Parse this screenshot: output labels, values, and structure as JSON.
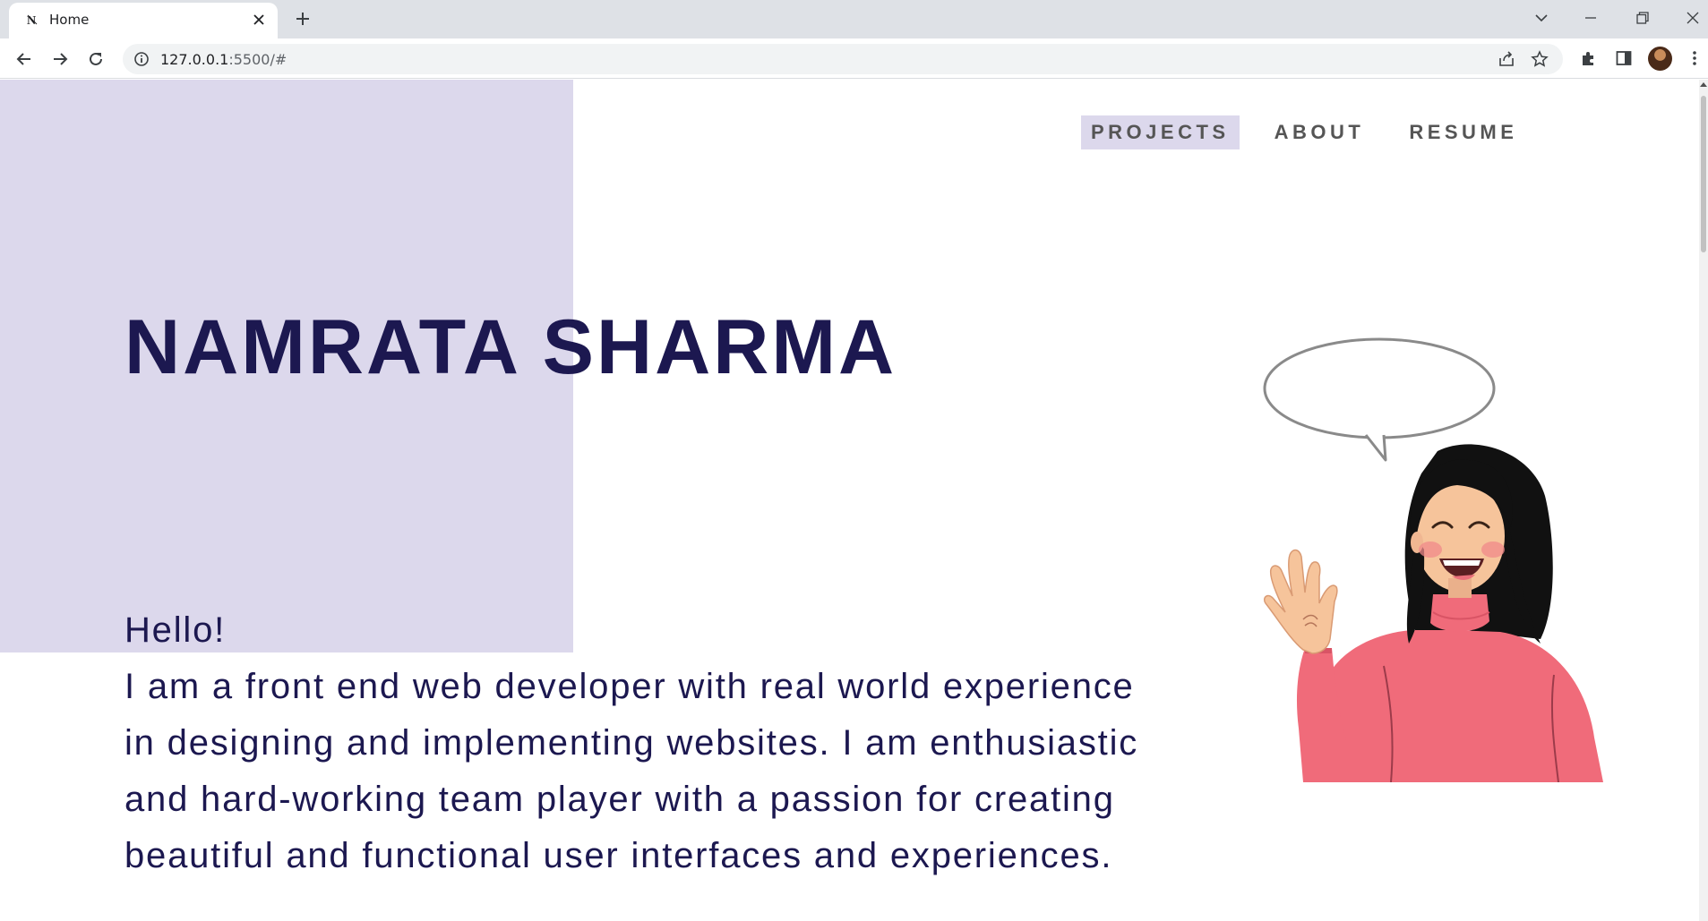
{
  "browser": {
    "tab": {
      "title": "Home",
      "favicon": "notion-n-icon"
    },
    "new_tab_label": "+",
    "address": {
      "url": "127.0.0.1:5500/#",
      "host": "127.0.0.1",
      "rest": ":5500/#"
    },
    "icons": {
      "back": "arrow-left-icon",
      "forward": "arrow-right-icon",
      "reload": "reload-icon",
      "site_info": "info-icon",
      "share": "share-icon",
      "bookmark": "star-icon",
      "extensions": "puzzle-icon",
      "side_panel": "side-panel-icon",
      "menu": "kebab-menu-icon",
      "tab_search": "chevron-down-icon",
      "minimize": "minimize-icon",
      "restore": "restore-icon",
      "close": "close-icon"
    }
  },
  "page": {
    "nav": [
      {
        "label": "PROJECTS",
        "active": true
      },
      {
        "label": "ABOUT",
        "active": false
      },
      {
        "label": "RESUME",
        "active": false
      }
    ],
    "name": "NAMRATA SHARMA",
    "greeting": "Hello!",
    "intro": "I am a front end web developer with real world experience in designing and implementing websites. I am enthusiastic and hard-working team player with a passion for creating beautiful and functional user interfaces and experiences.",
    "illustration": "waving-woman-with-speech-bubble"
  },
  "colors": {
    "accent_lavender": "#dcd8ec",
    "heading_navy": "#1c1850",
    "nav_text": "#555555",
    "sweater_pink": "#f06b7a",
    "chrome_bg": "#dee1e6"
  }
}
